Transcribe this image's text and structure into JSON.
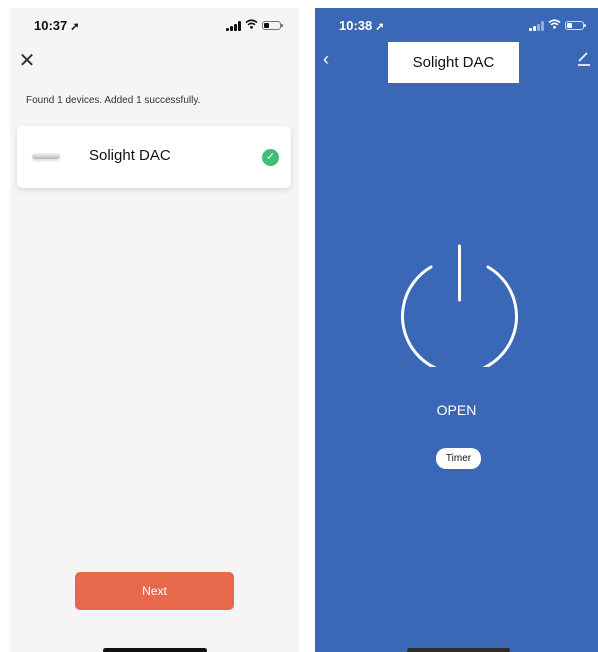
{
  "left": {
    "status": {
      "time": "10:37",
      "arrow": "➚"
    },
    "close_label": "✕",
    "found_text": "Found 1 devices. Added 1 successfully.",
    "device": {
      "name": "Solight DAC",
      "added": true,
      "check_glyph": "✓"
    },
    "next_label": "Next",
    "colors": {
      "accent": "#e8684b",
      "success": "#3fbf75"
    }
  },
  "right": {
    "status": {
      "time": "10:38",
      "arrow": "➚"
    },
    "back_label": "‹",
    "title": "Solight DAC",
    "state_label": "OPEN",
    "timer_label": "Timer",
    "colors": {
      "background": "#3a68b6"
    }
  },
  "icons": [
    "close-icon",
    "check-icon",
    "power-icon",
    "back-icon",
    "edit-icon",
    "wifi-icon",
    "battery-icon",
    "signal-icon"
  ]
}
